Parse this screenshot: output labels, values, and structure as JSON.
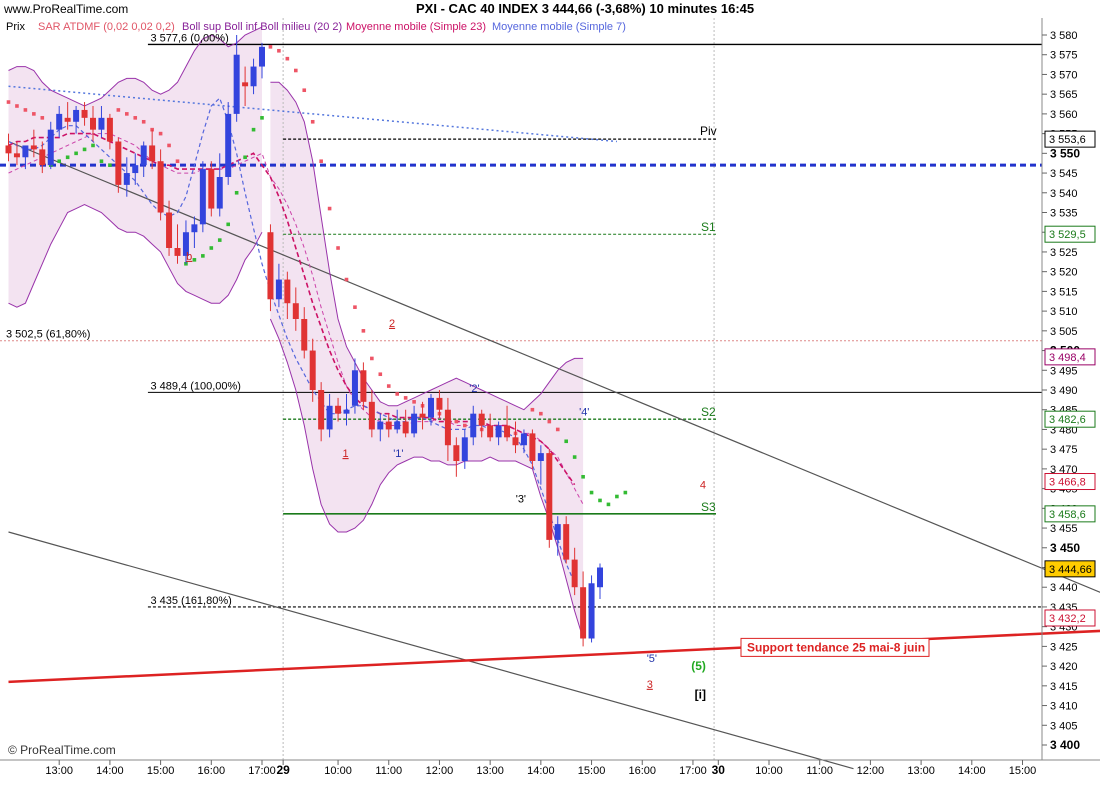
{
  "header": {
    "site": "www.ProRealTime.com",
    "symbol_line": "PXI - CAC 40 INDEX    3 444,66 (-3,68%)    10 minutes  16:45"
  },
  "legend": {
    "prix": "Prix",
    "sar": "SAR ATDMF (0,02 0,02 0,2)",
    "boll": "Boll sup Boll inf Boll milieu (20 2)",
    "mm23": "Moyenne mobile (Simple 23)",
    "mm7": "Moyenne mobile (Simple 7)"
  },
  "watermark": "© ProRealTime.com",
  "colors": {
    "up": "#3344dd",
    "down": "#e03333",
    "bollinger_fill": "#f3e3f1",
    "bollinger_line": "#9933aa",
    "mm23": "#cc1166",
    "mm7": "#5566dd",
    "sar_bull": "#33bb33",
    "sar_bear": "#ee5566",
    "support": "#dd2222",
    "s_levels": "#1a7a1a"
  },
  "levels": [
    {
      "key": "fib0",
      "label": "3 577,6 (0,00%)",
      "value": 3577.6
    },
    {
      "key": "fib618",
      "label": "3 502,5 (61,80%)",
      "value": 3502.5
    },
    {
      "key": "fib100",
      "label": "3 489,4 (100,00%)",
      "value": 3489.4
    },
    {
      "key": "fib1618",
      "label": "3 435 (161,80%)",
      "value": 3435
    },
    {
      "key": "piv",
      "label": "Piv",
      "value": 3553.6
    },
    {
      "key": "s1",
      "label": "S1",
      "value": 3529.5
    },
    {
      "key": "s2",
      "label": "S2",
      "value": 3482.6
    },
    {
      "key": "s3",
      "label": "S3",
      "value": 3458.6
    }
  ],
  "annotations": {
    "b": "b",
    "n1": "1",
    "n2": "2",
    "n3": "3",
    "n4": "4",
    "w1": "'1'",
    "w2": "'2'",
    "w3": "'3'",
    "w4": "'4'",
    "w5": "'5'",
    "p5": "(5)",
    "i": "[i]",
    "support": "Support tendance 25 mai-8 juin"
  },
  "chart_data": {
    "type": "candlestick",
    "timeframe": "10 minutes",
    "ylim": [
      3397,
      3584
    ],
    "y_ticks": [
      "3 400",
      "3 405",
      "3 410",
      "3 415",
      "3 420",
      "3 425",
      "3 430",
      "3 435",
      "3 440",
      "3 445",
      "3 450",
      "3 455",
      "3 460",
      "3 465",
      "3 470",
      "3 475",
      "3 480",
      "3 485",
      "3 490",
      "3 495",
      "3 500",
      "3 505",
      "3 510",
      "3 515",
      "3 520",
      "3 525",
      "3 530",
      "3 535",
      "3 540",
      "3 545",
      "3 550",
      "3 555",
      "3 560",
      "3 565",
      "3 570",
      "3 575",
      "3 580"
    ],
    "y_tick_values": [
      3400,
      3405,
      3410,
      3415,
      3420,
      3425,
      3430,
      3435,
      3440,
      3445,
      3450,
      3455,
      3460,
      3465,
      3470,
      3475,
      3480,
      3485,
      3490,
      3495,
      3500,
      3505,
      3510,
      3515,
      3520,
      3525,
      3530,
      3535,
      3540,
      3545,
      3550,
      3555,
      3560,
      3565,
      3570,
      3575,
      3580
    ],
    "y_tick_bold": [
      "3 400",
      "3 450",
      "3 500",
      "3 550"
    ],
    "x_ticks": [
      "13:00",
      "14:00",
      "15:00",
      "16:00",
      "17:00",
      "29",
      "10:00",
      "11:00",
      "12:00",
      "13:00",
      "14:00",
      "15:00",
      "16:00",
      "17:00",
      "30",
      "10:00",
      "11:00",
      "12:00",
      "13:00",
      "14:00",
      "15:00"
    ],
    "x_tick_bars": [
      6,
      12,
      18,
      24,
      30,
      32.5,
      39,
      45,
      51,
      57,
      63,
      69,
      75,
      81,
      84,
      90,
      96,
      102,
      108,
      114,
      120
    ],
    "price_tags": [
      {
        "label": "3 553,6",
        "value": 3553.6,
        "color": "#000000"
      },
      {
        "label": "3 529,5",
        "value": 3529.5,
        "color": "#1a7a1a"
      },
      {
        "label": "3 498,4",
        "value": 3498.4,
        "color": "#990066"
      },
      {
        "label": "3 482,6",
        "value": 3482.6,
        "color": "#1a7a1a"
      },
      {
        "label": "3 466,8",
        "value": 3466.8,
        "color": "#cc1133"
      },
      {
        "label": "3 458,6",
        "value": 3458.6,
        "color": "#1a7a1a"
      },
      {
        "label": "3 444,66",
        "value": 3444.66,
        "color": "#000000",
        "highlight": true
      },
      {
        "label": "3 432,2",
        "value": 3432.2,
        "color": "#cc1133"
      }
    ],
    "candles": [
      [
        3552,
        3555,
        3548,
        3550
      ],
      [
        3550,
        3553,
        3547,
        3549
      ],
      [
        3549,
        3551,
        3546,
        3552
      ],
      [
        3552,
        3556,
        3549,
        3551
      ],
      [
        3551,
        3553,
        3545,
        3547
      ],
      [
        3547,
        3558,
        3546,
        3556
      ],
      [
        3556,
        3562,
        3554,
        3560
      ],
      [
        3559,
        3563,
        3556,
        3558
      ],
      [
        3558,
        3562,
        3555,
        3561
      ],
      [
        3561,
        3563,
        3557,
        3559
      ],
      [
        3559,
        3562,
        3553,
        3556
      ],
      [
        3556,
        3562,
        3554,
        3559
      ],
      [
        3559,
        3560,
        3551,
        3553
      ],
      [
        3553,
        3554,
        3540,
        3542
      ],
      [
        3542,
        3549,
        3539,
        3545
      ],
      [
        3545,
        3550,
        3542,
        3547
      ],
      [
        3547,
        3553,
        3544,
        3552
      ],
      [
        3552,
        3556,
        3546,
        3548
      ],
      [
        3548,
        3551,
        3533,
        3535
      ],
      [
        3535,
        3538,
        3524,
        3526
      ],
      [
        3526,
        3532,
        3522,
        3524
      ],
      [
        3524,
        3533,
        3522,
        3530
      ],
      [
        3530,
        3534,
        3526,
        3532
      ],
      [
        3532,
        3548,
        3530,
        3546
      ],
      [
        3546,
        3548,
        3534,
        3536
      ],
      [
        3536,
        3550,
        3534,
        3544
      ],
      [
        3544,
        3563,
        3542,
        3560
      ],
      [
        3560,
        3580,
        3558,
        3575
      ],
      [
        3568,
        3572,
        3562,
        3567
      ],
      [
        3567,
        3574,
        3565,
        3572
      ],
      [
        3572,
        3578,
        3569,
        3577
      ],
      [
        3530,
        3532,
        3510,
        3513
      ],
      [
        3513,
        3522,
        3511,
        3518
      ],
      [
        3518,
        3520,
        3508,
        3512
      ],
      [
        3512,
        3516,
        3505,
        3508
      ],
      [
        3508,
        3511,
        3498,
        3500
      ],
      [
        3500,
        3503,
        3487,
        3490
      ],
      [
        3490,
        3492,
        3477,
        3480
      ],
      [
        3480,
        3489,
        3478,
        3486
      ],
      [
        3486,
        3488,
        3482,
        3484
      ],
      [
        3484,
        3489,
        3481,
        3485
      ],
      [
        3486,
        3498,
        3484,
        3495
      ],
      [
        3495,
        3497,
        3485,
        3487
      ],
      [
        3487,
        3490,
        3478,
        3480
      ],
      [
        3480,
        3484,
        3477,
        3482
      ],
      [
        3482,
        3484,
        3478,
        3480
      ],
      [
        3480,
        3485,
        3479,
        3482
      ],
      [
        3482,
        3485,
        3478,
        3479
      ],
      [
        3479,
        3486,
        3478,
        3484
      ],
      [
        3484,
        3487,
        3480,
        3483
      ],
      [
        3483,
        3489,
        3481,
        3488
      ],
      [
        3488,
        3490,
        3483,
        3485
      ],
      [
        3485,
        3488,
        3472,
        3476
      ],
      [
        3476,
        3478,
        3468,
        3472
      ],
      [
        3472,
        3480,
        3470,
        3478
      ],
      [
        3478,
        3486,
        3476,
        3484
      ],
      [
        3484,
        3485,
        3478,
        3481
      ],
      [
        3481,
        3484,
        3477,
        3478
      ],
      [
        3478,
        3482,
        3476,
        3481
      ],
      [
        3481,
        3486,
        3477,
        3478
      ],
      [
        3478,
        3482,
        3474,
        3476
      ],
      [
        3476,
        3480,
        3474,
        3479
      ],
      [
        3479,
        3480,
        3470,
        3472
      ],
      [
        3472,
        3476,
        3466,
        3474
      ],
      [
        3474,
        3475,
        3450,
        3452
      ],
      [
        3452,
        3458,
        3448,
        3456
      ],
      [
        3456,
        3458,
        3446,
        3447
      ],
      [
        3447,
        3450,
        3438,
        3440
      ],
      [
        3440,
        3444,
        3425,
        3427
      ],
      [
        3427,
        3443,
        3426,
        3441
      ],
      [
        3440,
        3446,
        3437,
        3445
      ]
    ],
    "day_breaks": [
      {
        "label": "29",
        "after_bar": 31
      },
      {
        "label": "30",
        "after_bar": 84
      }
    ],
    "sar": {
      "points": [
        [
          0,
          3563
        ],
        [
          1,
          3562
        ],
        [
          2,
          3561
        ],
        [
          3,
          3560
        ],
        [
          4,
          3559
        ],
        [
          5,
          3547
        ],
        [
          6,
          3548
        ],
        [
          7,
          3549
        ],
        [
          8,
          3550
        ],
        [
          9,
          3551
        ],
        [
          10,
          3552
        ],
        [
          11,
          3548
        ],
        [
          12,
          3547
        ],
        [
          13,
          3561
        ],
        [
          14,
          3560
        ],
        [
          15,
          3559
        ],
        [
          16,
          3558
        ],
        [
          17,
          3556
        ],
        [
          18,
          3555
        ],
        [
          19,
          3552
        ],
        [
          20,
          3548
        ],
        [
          21,
          3522
        ],
        [
          22,
          3523
        ],
        [
          23,
          3524
        ],
        [
          24,
          3526
        ],
        [
          25,
          3528
        ],
        [
          26,
          3532
        ],
        [
          27,
          3540
        ],
        [
          28,
          3549
        ],
        [
          29,
          3556
        ],
        [
          30,
          3559
        ],
        [
          31,
          3577
        ],
        [
          32,
          3576
        ],
        [
          33,
          3574
        ],
        [
          34,
          3571
        ],
        [
          35,
          3566
        ],
        [
          36,
          3558
        ],
        [
          37,
          3548
        ],
        [
          38,
          3536
        ],
        [
          39,
          3526
        ],
        [
          40,
          3518
        ],
        [
          41,
          3511
        ],
        [
          42,
          3505
        ],
        [
          43,
          3498
        ],
        [
          44,
          3494
        ],
        [
          45,
          3491
        ],
        [
          46,
          3489
        ],
        [
          47,
          3488
        ],
        [
          48,
          3487
        ],
        [
          49,
          3486
        ],
        [
          50,
          3485
        ],
        [
          51,
          3484
        ],
        [
          52,
          3483
        ],
        [
          53,
          3482
        ],
        [
          54,
          3481
        ],
        [
          55,
          3481
        ],
        [
          56,
          3480
        ],
        [
          57,
          3480
        ],
        [
          58,
          3480
        ],
        [
          59,
          3479
        ],
        [
          60,
          3479
        ],
        [
          61,
          3478
        ],
        [
          62,
          3485
        ],
        [
          63,
          3484
        ],
        [
          64,
          3482
        ],
        [
          65,
          3480
        ],
        [
          66,
          3477
        ],
        [
          67,
          3473
        ],
        [
          68,
          3468
        ],
        [
          69,
          3464
        ],
        [
          70,
          3462
        ],
        [
          71,
          3461
        ],
        [
          72,
          3463
        ],
        [
          73,
          3464
        ]
      ],
      "bull_bars": [
        5,
        6,
        7,
        8,
        9,
        10,
        11,
        12,
        21,
        22,
        23,
        24,
        25,
        26,
        27,
        28,
        29,
        30,
        66,
        67,
        68,
        69,
        70,
        71,
        72,
        73
      ]
    },
    "bollinger": {
      "upper": [
        3571,
        3572,
        3572,
        3571,
        3568,
        3566,
        3565,
        3564,
        3563,
        3562,
        3563,
        3564,
        3566,
        3568,
        3569,
        3569,
        3568,
        3566,
        3565,
        3566,
        3568,
        3572,
        3576,
        3579,
        3580,
        3579,
        3577,
        3578,
        3580,
        3581,
        3582,
        3568,
        3568,
        3566,
        3563,
        3558,
        3548,
        3534,
        3520,
        3508,
        3501,
        3497,
        3493,
        3490,
        3487,
        3486,
        3486,
        3487,
        3488,
        3489,
        3490,
        3491,
        3492,
        3493,
        3492,
        3491,
        3490,
        3489,
        3488,
        3487,
        3486,
        3485,
        3487,
        3489,
        3492,
        3495,
        3497,
        3498,
        3498
      ],
      "lower": [
        3512,
        3511,
        3512,
        3517,
        3522,
        3527,
        3531,
        3535,
        3536,
        3537,
        3536,
        3535,
        3533,
        3531,
        3530,
        3530,
        3529,
        3527,
        3525,
        3521,
        3517,
        3515,
        3514,
        3513,
        3512,
        3512,
        3514,
        3518,
        3523,
        3526,
        3530,
        3508,
        3503,
        3497,
        3490,
        3481,
        3470,
        3461,
        3456,
        3454,
        3454,
        3455,
        3457,
        3461,
        3466,
        3469,
        3471,
        3472,
        3473,
        3473,
        3472,
        3472,
        3471,
        3471,
        3472,
        3472,
        3472,
        3473,
        3472,
        3472,
        3472,
        3471,
        3470,
        3463,
        3457,
        3450,
        3442,
        3434,
        3427
      ],
      "mid": [
        3545,
        3546,
        3547,
        3548,
        3549,
        3550,
        3551,
        3552,
        3553,
        3554,
        3555,
        3555,
        3555,
        3554,
        3553,
        3552,
        3550,
        3548,
        3547,
        3546,
        3545,
        3545,
        3545,
        3546,
        3546,
        3546,
        3546,
        3547,
        3548,
        3549,
        3550,
        3544,
        3541,
        3537,
        3532,
        3526,
        3519,
        3511,
        3504,
        3497,
        3491,
        3487,
        3485,
        3483,
        3482,
        3481,
        3481,
        3481,
        3482,
        3482,
        3482,
        3483,
        3482,
        3481,
        3481,
        3481,
        3481,
        3481,
        3481,
        3481,
        3480,
        3479,
        3479,
        3477,
        3475,
        3473,
        3469,
        3465,
        3461
      ]
    },
    "mm23": [
      3552,
      3553,
      3553,
      3554,
      3554,
      3554,
      3554,
      3555,
      3555,
      3555,
      3555,
      3554,
      3553,
      3552,
      3551,
      3550,
      3549,
      3548,
      3547,
      3547,
      3546,
      3546,
      3546,
      3546,
      3546,
      3546,
      3547,
      3548,
      3549,
      3550,
      3547,
      3544,
      3539,
      3533,
      3526,
      3519,
      3512,
      3506,
      3500,
      3495,
      3491,
      3488,
      3486,
      3485,
      3484,
      3484,
      3483,
      3483,
      3483,
      3483,
      3483,
      3482,
      3482,
      3482,
      3482,
      3482,
      3482,
      3481,
      3481,
      3481,
      3480,
      3479,
      3478,
      3477,
      3475,
      3472,
      3469,
      3466
    ],
    "mm7": [
      3553,
      3552,
      3551,
      3551,
      3552,
      3554,
      3556,
      3557,
      3557,
      3555,
      3553,
      3551,
      3549,
      3547,
      3545,
      3543,
      3540,
      3537,
      3535,
      3534,
      3535,
      3539,
      3547,
      3555,
      3562,
      3564,
      3558,
      3550,
      3540,
      3531,
      3522,
      3515,
      3509,
      3503,
      3498,
      3494,
      3490,
      3487,
      3484,
      3484,
      3485,
      3486,
      3486,
      3485,
      3484,
      3483,
      3482,
      3482,
      3483,
      3483,
      3482,
      3481,
      3480,
      3480,
      3480,
      3481,
      3481,
      3480,
      3480,
      3479,
      3478,
      3475,
      3471,
      3465,
      3459,
      3452,
      3446,
      3441
    ],
    "trendlines": [
      {
        "name": "downtrend-upper",
        "points": [
          [
            0,
            3553
          ],
          [
            130,
            3438
          ]
        ],
        "color": "#555555"
      },
      {
        "name": "downtrend-lower",
        "points": [
          [
            0,
            3454
          ],
          [
            100,
            3394
          ]
        ],
        "color": "#555555"
      },
      {
        "name": "mm-blue-dotted",
        "points": [
          [
            0,
            3567
          ],
          [
            72,
            3553
          ]
        ],
        "color": "#5577dd"
      },
      {
        "name": "support-trend",
        "points": [
          [
            0,
            3416
          ],
          [
            130,
            3429
          ]
        ],
        "color": "#dd2222"
      }
    ]
  }
}
